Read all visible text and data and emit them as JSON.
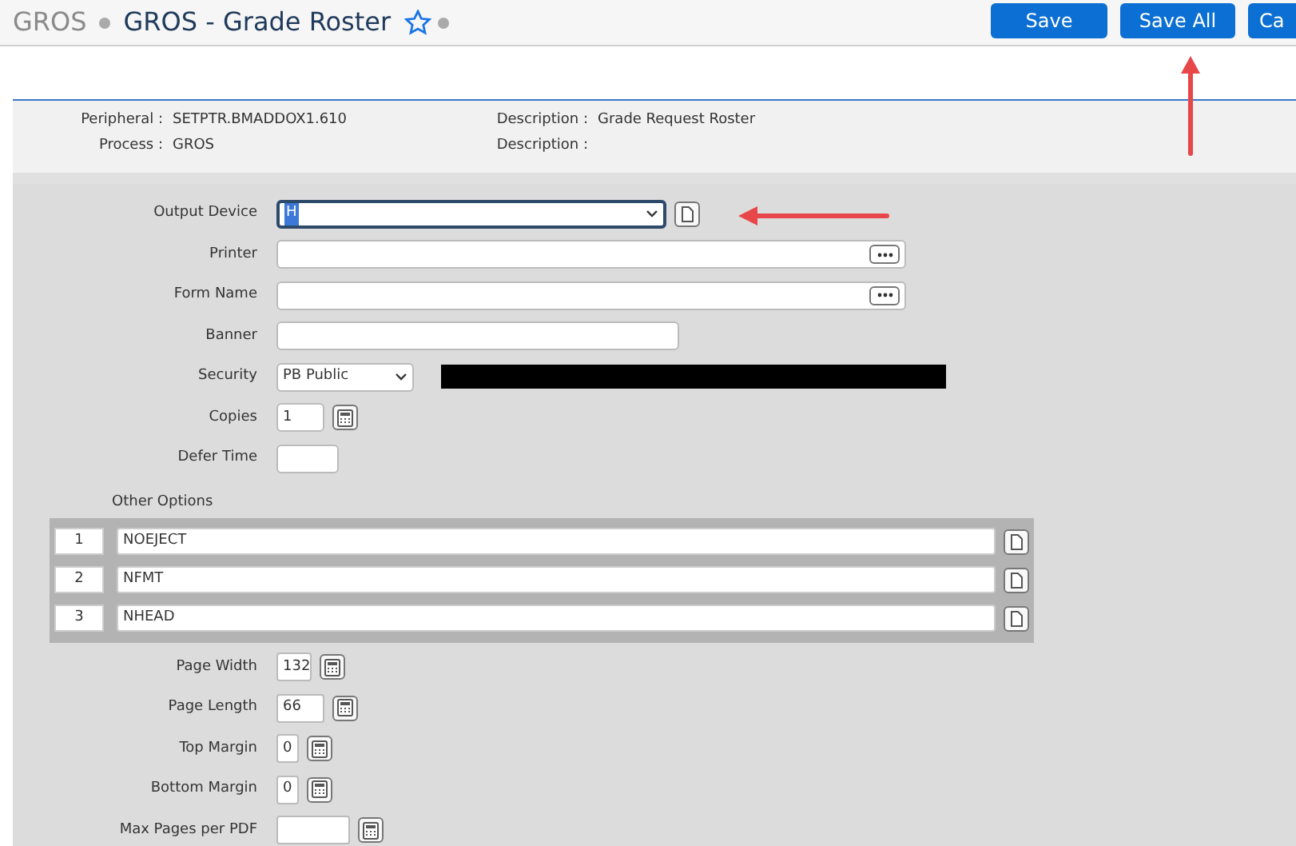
{
  "header": {
    "breadcrumb": "GROS",
    "title": "GROS - Grade Roster",
    "favorite": false,
    "buttons": [
      "Save",
      "Save All",
      "Ca"
    ]
  },
  "info": [
    {
      "label": "Peripheral :",
      "value": "SETPTR.BMADDOX1.610"
    },
    {
      "label": "Description :",
      "value": "Grade Request Roster"
    },
    {
      "label": "Process :",
      "value": "GROS"
    },
    {
      "label": "Description :"
    }
  ],
  "fields": [
    {
      "kind": "select",
      "label": "Output Device",
      "value": "H",
      "focused": true
    },
    {
      "kind": "lookup",
      "label": "Printer"
    },
    {
      "kind": "lookup",
      "label": "Form Name"
    },
    {
      "kind": "text",
      "label": "Banner"
    },
    {
      "kind": "select",
      "label": "Security",
      "value": "PB Public",
      "redacted": true
    },
    {
      "kind": "number",
      "label": "Copies",
      "value": "1"
    },
    {
      "kind": "text",
      "label": "Defer Time"
    }
  ],
  "other_options": {
    "label": "Other Options",
    "rows": [
      {
        "number": "1",
        "value": "NOEJECT"
      },
      {
        "number": "2",
        "value": "NFMT"
      },
      {
        "number": "3",
        "value": "NHEAD"
      }
    ]
  },
  "page_fields": [
    {
      "label": "Page Width",
      "value": "132"
    },
    {
      "label": "Page Length",
      "value": "66"
    },
    {
      "label": "Top Margin",
      "value": "0"
    },
    {
      "label": "Bottom Margin",
      "value": "0"
    },
    {
      "label": "Max Pages per PDF"
    }
  ]
}
